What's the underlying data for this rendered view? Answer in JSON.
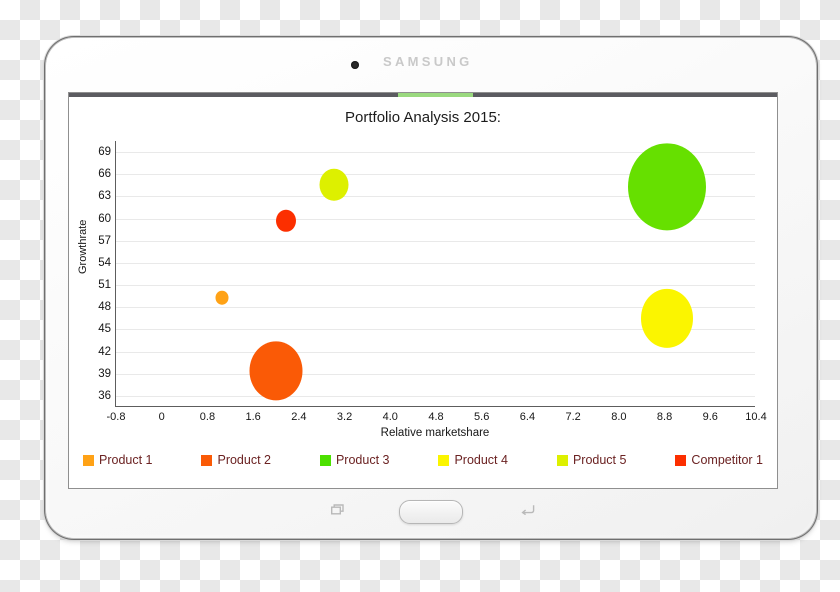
{
  "device": {
    "brand": "SAMSUNG",
    "camera_icon": "camera-dot",
    "nav": {
      "recent_apps_icon": "recent-apps-icon",
      "home_button_label": "",
      "back_icon": "back-icon"
    },
    "status_bar": {
      "progress_color": "#9ad97f",
      "bar_color": "#5b5b60"
    }
  },
  "chart_data": {
    "type": "scatter",
    "title": "Portfolio Analysis 2015:",
    "xlabel": "Relative marketshare",
    "ylabel": "Growthrate",
    "xlim": [
      -0.8,
      10.4
    ],
    "ylim": [
      34.5,
      70.5
    ],
    "grid": true,
    "legend_position": "bottom",
    "xticks": [
      "-0.8",
      "0",
      "0.8",
      "1.6",
      "2.4",
      "3.2",
      "4.0",
      "4.8",
      "5.6",
      "6.4",
      "7.2",
      "8.0",
      "8.8",
      "9.6",
      "10.4"
    ],
    "xtick_values": [
      -0.8,
      0,
      0.8,
      1.6,
      2.4,
      3.2,
      4.0,
      4.8,
      5.6,
      6.4,
      7.2,
      8.0,
      8.8,
      9.6,
      10.4
    ],
    "yticks": [
      "69",
      "66",
      "63",
      "60",
      "57",
      "54",
      "51",
      "48",
      "45",
      "42",
      "39",
      "36"
    ],
    "ytick_values": [
      69,
      66,
      63,
      60,
      57,
      54,
      51,
      48,
      45,
      42,
      39,
      36
    ],
    "series": [
      {
        "name": "Product 1",
        "x": 1.05,
        "y": 49.3,
        "size": 13,
        "color": "#FFA216"
      },
      {
        "name": "Product 2",
        "x": 2.0,
        "y": 39.4,
        "size": 53,
        "color": "#FA5A06"
      },
      {
        "name": "Product 3",
        "x": 8.85,
        "y": 64.3,
        "size": 78,
        "color": "#66E000"
      },
      {
        "name": "Product 4",
        "x": 8.85,
        "y": 46.5,
        "size": 52,
        "color": "#FBF500"
      },
      {
        "name": "Product 5",
        "x": 3.02,
        "y": 64.6,
        "size": 29,
        "color": "#DDF000"
      },
      {
        "name": "Competitor 1",
        "x": 2.18,
        "y": 59.7,
        "size": 20,
        "color": "#FC2F00"
      }
    ],
    "legend": [
      {
        "label": "Product 1",
        "color": "#FFA216"
      },
      {
        "label": "Product 2",
        "color": "#FA5A06"
      },
      {
        "label": "Product 3",
        "color": "#4CE000"
      },
      {
        "label": "Product 4",
        "color": "#FBF500"
      },
      {
        "label": "Product 5",
        "color": "#DDF000"
      },
      {
        "label": "Competitor 1",
        "color": "#FC2F00"
      }
    ]
  }
}
